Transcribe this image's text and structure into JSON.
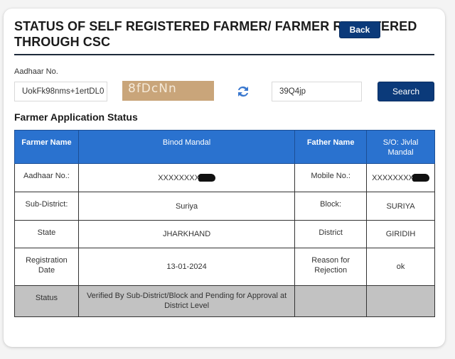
{
  "header": {
    "title": "STATUS OF SELF REGISTERED FARMER/ FARMER REGISTERED THROUGH CSC",
    "back_label": "Back"
  },
  "search_form": {
    "aadhaar_label": "Aadhaar No.",
    "aadhaar_value": "UokFk98nms+1ertDL0",
    "captcha_text": "8fDcNn",
    "refresh_icon": "refresh-icon",
    "captcha_input_value": "39Q4jp",
    "search_label": "Search"
  },
  "application": {
    "section_title": "Farmer Application Status",
    "header_row": {
      "farmer_name_label": "Farmer Name",
      "farmer_name_value": "Binod Mandal",
      "father_name_label": "Father Name",
      "father_name_value": "S/O: Jivlal Mandal"
    },
    "rows": [
      {
        "label1": "Aadhaar No.:",
        "value1": "XXXXXXXX",
        "label2": "Mobile No.:",
        "value2": "XXXXXXXX"
      },
      {
        "label1": "Sub-District:",
        "value1": "Suriya",
        "label2": "Block:",
        "value2": "SURIYA"
      },
      {
        "label1": "State",
        "value1": "JHARKHAND",
        "label2": "District",
        "value2": "GIRIDIH"
      },
      {
        "label1": "Registration Date",
        "value1": "13-01-2024",
        "label2": "Reason for Rejection",
        "value2": "ok"
      }
    ],
    "status_row": {
      "label": "Status",
      "value": "Verified By Sub-District/Block and Pending for Approval at District Level",
      "extra1": "",
      "extra2": ""
    }
  },
  "colors": {
    "primary_button": "#0b3a7a",
    "table_header": "#2a72cf",
    "status_row": "#c2c2c2",
    "captcha_bg": "#c9a57a"
  }
}
